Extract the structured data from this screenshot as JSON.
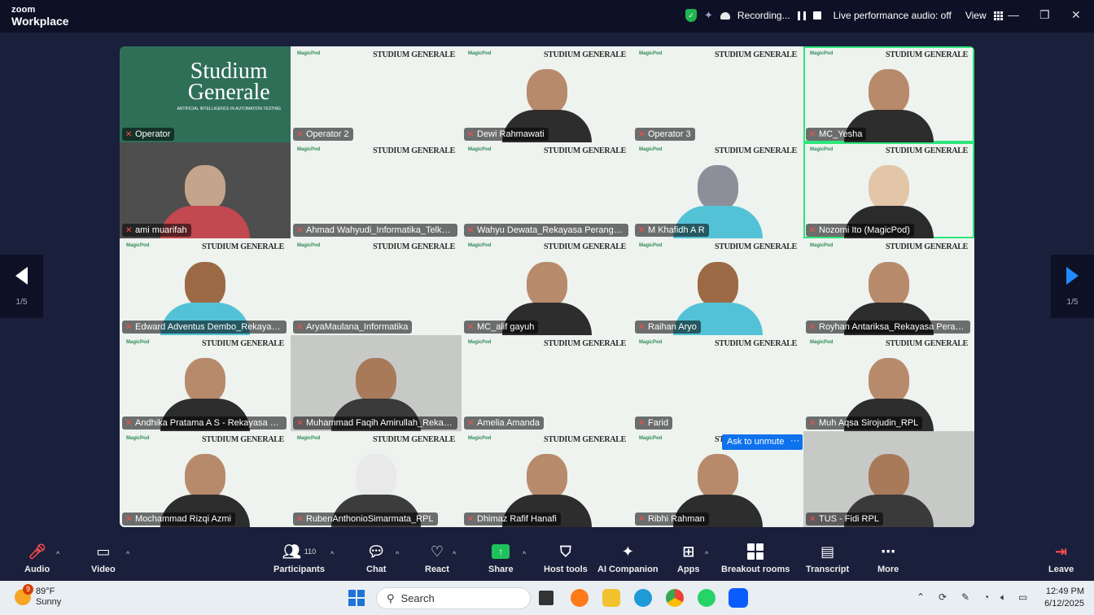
{
  "app": {
    "brand_top": "zoom",
    "brand_bottom": "Workplace"
  },
  "titlebar": {
    "recording_label": "Recording...",
    "audio_status": "Live performance audio: off",
    "view_label": "View",
    "minimize": "—",
    "restore": "❐",
    "close": "✕"
  },
  "slide": {
    "header": "MagicPod",
    "title": "STUDIUM GENERALE",
    "big_title_1": "Studium",
    "big_title_2": "Generale",
    "subtitle": "ARTIFICIAL INTELLIGENCE IN AUTOMATION TESTING"
  },
  "participants": [
    {
      "name": "Operator",
      "kind": "slide-big"
    },
    {
      "name": "Operator 2",
      "kind": "slide"
    },
    {
      "name": "Dewi Rahmawati",
      "kind": "person"
    },
    {
      "name": "Operator 3",
      "kind": "slide"
    },
    {
      "name": "MC_Yesha",
      "kind": "person",
      "active": true
    },
    {
      "name": "ami muarifah",
      "kind": "person-dark"
    },
    {
      "name": "Ahmad Wahyudi_Informatika_Telkom",
      "kind": "slide"
    },
    {
      "name": "Wahyu Dewata_Rekayasa Perangkat...",
      "kind": "slide"
    },
    {
      "name": "M Khafidh A R",
      "kind": "avatar-wolf"
    },
    {
      "name": "Nozomi Ito (MagicPod)",
      "kind": "person-green"
    },
    {
      "name": "Edward Adventus Dembo_Rekayasa ...",
      "kind": "avatar-dog"
    },
    {
      "name": "AryaMaulana_Informatika",
      "kind": "slide"
    },
    {
      "name": "MC_alif gayuh",
      "kind": "person"
    },
    {
      "name": "Raihan Aryo",
      "kind": "avatar-dog"
    },
    {
      "name": "Royhan Antariksa_Rekayasa Perangk...",
      "kind": "person"
    },
    {
      "name": "Andhika Pratama A S - Rekayasa Pera...",
      "kind": "person"
    },
    {
      "name": "Muhammad Faqih Amirullah_Rekaya...",
      "kind": "person-gray"
    },
    {
      "name": "Amelia Amanda",
      "kind": "slide"
    },
    {
      "name": "Farid",
      "kind": "slide"
    },
    {
      "name": "Muh Aqsa Sirojudin_RPL",
      "kind": "person"
    },
    {
      "name": "Mochammad Rizqi Azmi",
      "kind": "person"
    },
    {
      "name": "RubenAnthonioSimarmata_RPL",
      "kind": "avatar-seal"
    },
    {
      "name": "Dhimaz Rafif Hanafi",
      "kind": "person"
    },
    {
      "name": "Ribhi Rahman",
      "kind": "person"
    },
    {
      "name": "TUS - Fidi RPL",
      "kind": "person-gray"
    }
  ],
  "overlay": {
    "ask_to_unmute": "Ask to unmute",
    "more": "···"
  },
  "pager": {
    "left_page": "1/5",
    "right_page": "1/5"
  },
  "toolbar": {
    "audio": "Audio",
    "video": "Video",
    "participants": "Participants",
    "participants_count": "110",
    "chat": "Chat",
    "react": "React",
    "share": "Share",
    "host_tools": "Host tools",
    "ai_companion": "AI Companion",
    "apps": "Apps",
    "breakout_rooms": "Breakout rooms",
    "transcript": "Transcript",
    "more": "More",
    "leave": "Leave"
  },
  "taskbar": {
    "weather_temp": "89°F",
    "weather_desc": "Sunny",
    "weather_badge": "9",
    "search_label": "Search",
    "time": "12:49 PM",
    "date": "6/12/2025"
  },
  "colors": {
    "accent": "#0e72ed",
    "active_speaker": "#2ee67c",
    "share_green": "#1fc25a",
    "mute_red": "#ff4d4d"
  }
}
